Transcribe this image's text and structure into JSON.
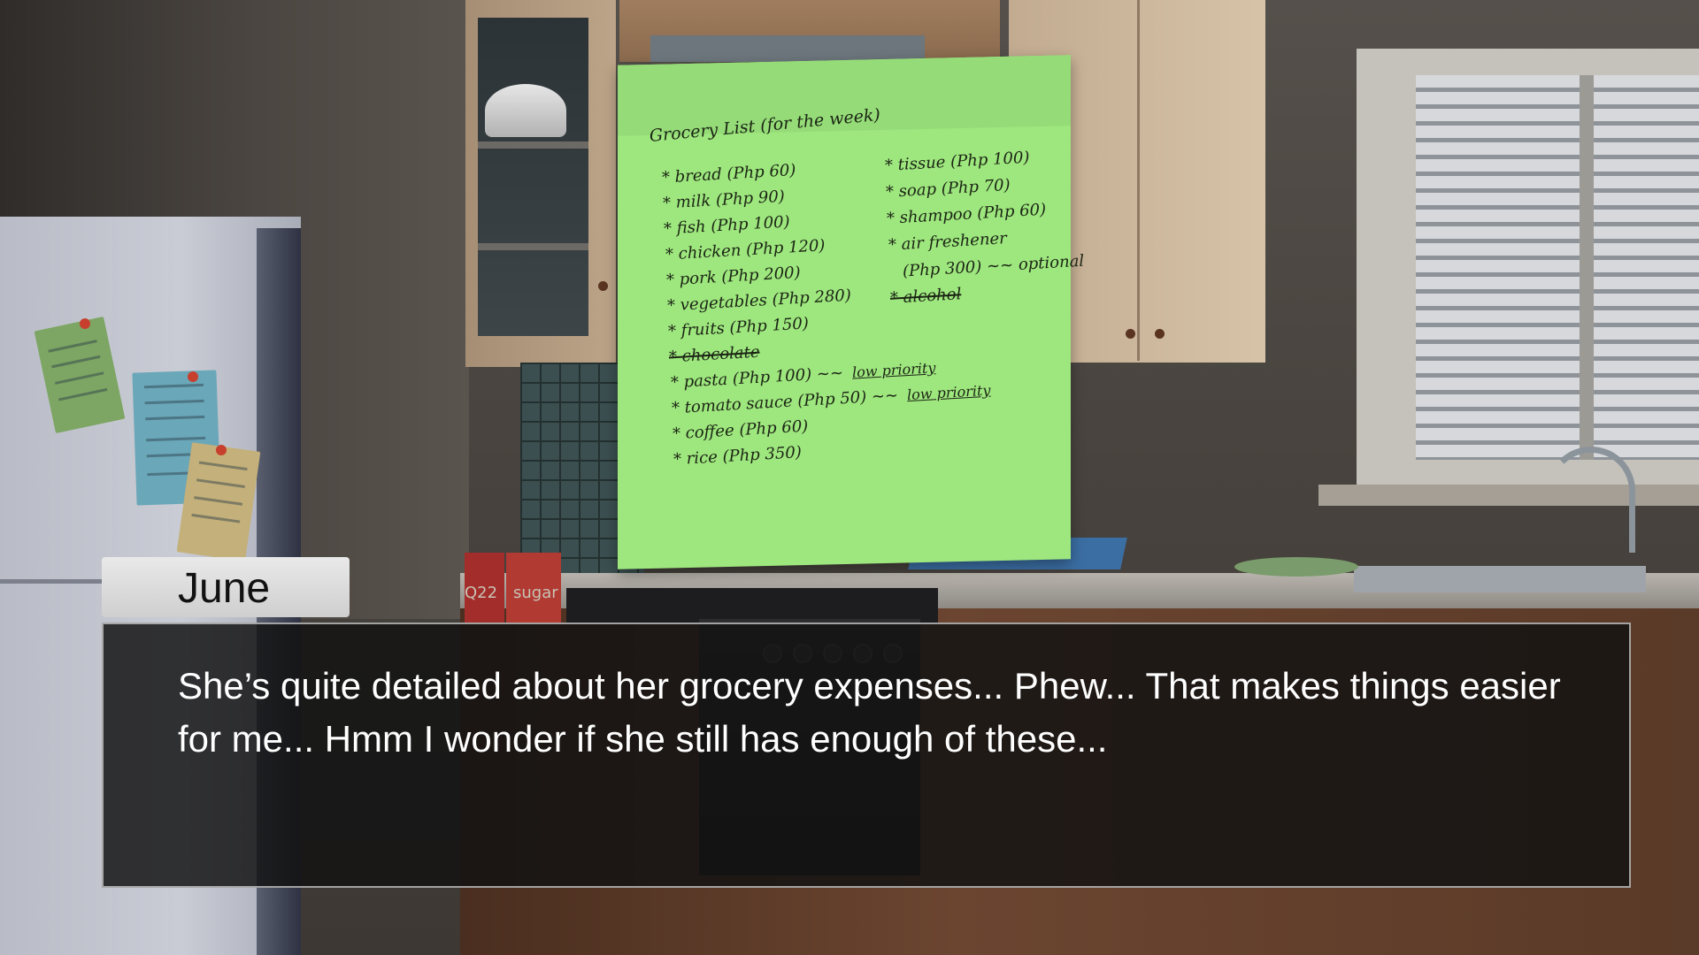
{
  "note": {
    "title": "Grocery List (for the week)",
    "left_column": [
      {
        "text": "* bread (Php 60)",
        "struck": false,
        "annotation": ""
      },
      {
        "text": "* milk (Php 90)",
        "struck": false,
        "annotation": ""
      },
      {
        "text": "* fish (Php 100)",
        "struck": false,
        "annotation": ""
      },
      {
        "text": "* chicken (Php 120)",
        "struck": false,
        "annotation": ""
      },
      {
        "text": "* pork (Php 200)",
        "struck": false,
        "annotation": ""
      },
      {
        "text": "* vegetables (Php 280)",
        "struck": false,
        "annotation": ""
      },
      {
        "text": "* fruits (Php 150)",
        "struck": false,
        "annotation": ""
      },
      {
        "text": "* chocolate",
        "struck": true,
        "annotation": ""
      },
      {
        "text": "* pasta (Php 100) ~~",
        "struck": false,
        "annotation": "low priority"
      },
      {
        "text": "* tomato sauce (Php 50) ~~",
        "struck": false,
        "annotation": "low priority"
      },
      {
        "text": "* coffee (Php 60)",
        "struck": false,
        "annotation": ""
      },
      {
        "text": "* rice (Php 350)",
        "struck": false,
        "annotation": ""
      }
    ],
    "right_column": [
      {
        "text": "* tissue (Php 100)",
        "struck": false,
        "annotation": ""
      },
      {
        "text": "* soap (Php 70)",
        "struck": false,
        "annotation": ""
      },
      {
        "text": "* shampoo (Php 60)",
        "struck": false,
        "annotation": ""
      },
      {
        "text": "* air freshener",
        "struck": false,
        "annotation": ""
      },
      {
        "text": "(Php 300) ~~ optional",
        "struck": false,
        "annotation": ""
      },
      {
        "text": "* alcohol",
        "struck": true,
        "annotation": ""
      }
    ]
  },
  "fridge_notes": [
    "green",
    "blue",
    "yellow"
  ],
  "boxes": {
    "left_label": "Q22",
    "right_label": "sugar"
  },
  "dialogue": {
    "speaker": "June",
    "text": "She’s quite detailed about her grocery expenses... Phew... That makes things easier for me... Hmm I wonder if she still has enough of these..."
  },
  "colors": {
    "note_paper": "#9ee77e",
    "dialog_bg": "#121212",
    "namebox_bg": "#dcdcdc"
  }
}
